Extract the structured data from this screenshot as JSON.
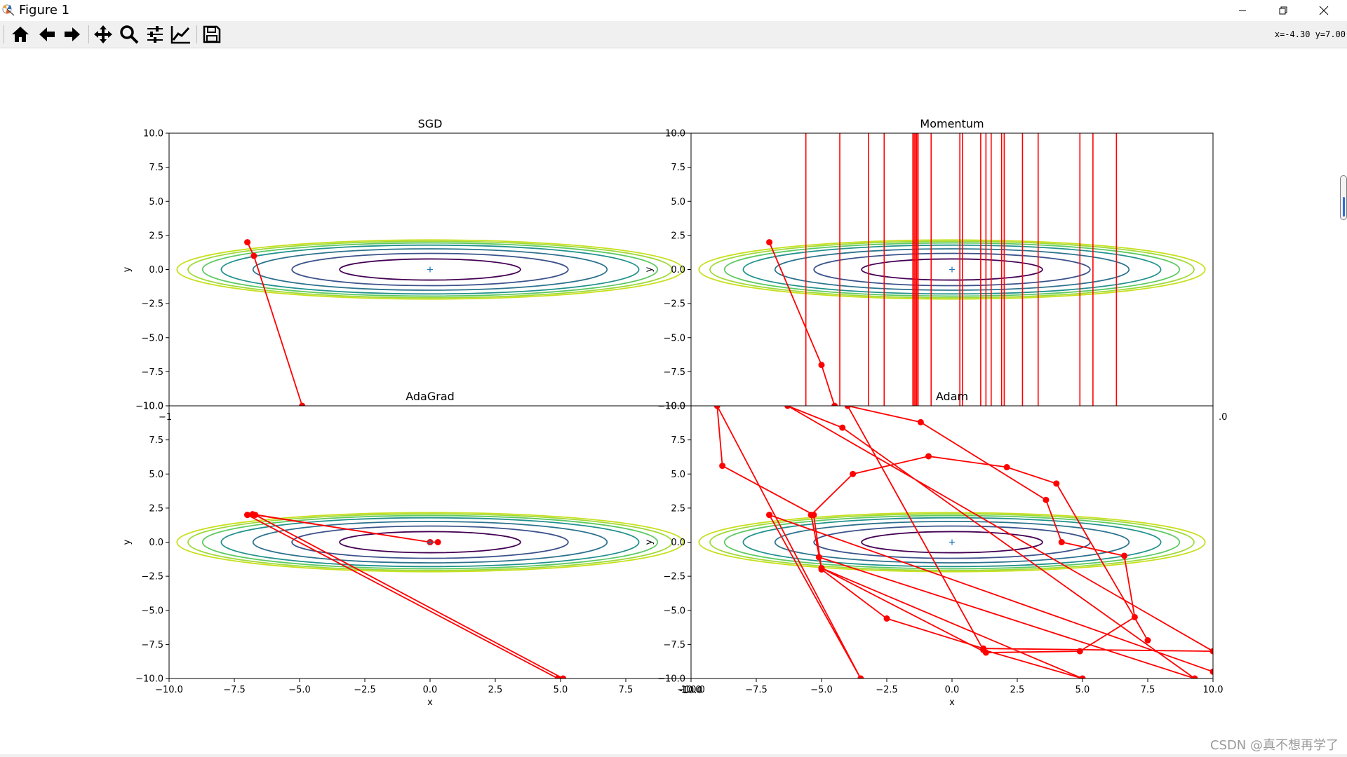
{
  "window": {
    "title": "Figure 1",
    "controls": {
      "minimize": "minimize-icon",
      "restore": "restore-icon",
      "close": "close-icon"
    }
  },
  "toolbar": {
    "buttons": [
      "home-icon",
      "back-icon",
      "forward-icon",
      "pan-icon",
      "zoom-icon",
      "subplots-icon",
      "customize-icon",
      "save-icon"
    ],
    "coords": "x=-4.30 y=7.00"
  },
  "figure": {
    "tick_labels": [
      "-10.0",
      "-7.5",
      "-5.0",
      "-2.5",
      "0.0",
      "2.5",
      "5.0",
      "7.5",
      "10.0"
    ],
    "overlap_labels": {
      "bottom_x": "-10.0",
      "left_sgd_x": "−1",
      "right_momentum_x": ".0"
    },
    "xlabel": "x",
    "ylabel": "y",
    "colors": {
      "path": "#ff0000",
      "marker": "#1f77b4",
      "axes": "#000000"
    },
    "contour_colors": [
      "#440154",
      "#3b528b",
      "#21918c",
      "#5ec962",
      "#fde725"
    ]
  },
  "chart_data": [
    {
      "type": "line",
      "title": "SGD",
      "xlabel": "",
      "ylabel": "y",
      "xlim": [
        -10,
        10
      ],
      "ylim": [
        -10,
        10
      ],
      "contour": "f(x,y) = x^2/20 + y^2",
      "minimum": [
        0,
        0
      ],
      "x": [
        -7.0,
        -6.75,
        -4.9
      ],
      "y": [
        2.0,
        1.0,
        -10.0
      ]
    },
    {
      "type": "line",
      "title": "Momentum",
      "xlabel": "",
      "ylabel": "y",
      "xlim": [
        -10,
        10
      ],
      "ylim": [
        -10,
        10
      ],
      "contour": "f(x,y) = x^2/20 + y^2",
      "minimum": [
        0,
        0
      ],
      "x": [
        -7.0,
        -5.0,
        -4.5
      ],
      "y": [
        2.0,
        -7.0,
        -10.0
      ],
      "vertical_lines_x": [
        -5.6,
        -4.3,
        -3.2,
        -2.6,
        -1.5,
        -1.45,
        -1.4,
        -1.35,
        -1.3,
        -0.8,
        0.3,
        0.4,
        1.1,
        1.3,
        1.5,
        1.9,
        2.0,
        2.7,
        3.3,
        4.9,
        5.4,
        6.3
      ]
    },
    {
      "type": "line",
      "title": "AdaGrad",
      "xlabel": "x",
      "ylabel": "y",
      "xlim": [
        -10,
        10
      ],
      "ylim": [
        -10,
        10
      ],
      "contour": "f(x,y) = x^2/20 + y^2",
      "minimum": [
        0,
        0
      ],
      "x": [
        -7.0,
        -6.8,
        0.0,
        0.3,
        0.0,
        -6.7,
        5.1,
        4.9,
        -7.0
      ],
      "y": [
        2.0,
        2.05,
        0.0,
        0.0,
        0.0,
        2.0,
        -10.0,
        -10.0,
        2.0
      ]
    },
    {
      "type": "line",
      "title": "Adam",
      "xlabel": "x",
      "ylabel": "y",
      "xlim": [
        -10,
        10
      ],
      "ylim": [
        -10,
        10
      ],
      "contour": "f(x,y) = x^2/20 + y^2",
      "minimum": [
        0,
        0
      ],
      "x": [
        -7.0,
        10.0,
        -7.0,
        -3.5,
        -9.0,
        -8.8,
        -5.3,
        -5.0,
        -2.5,
        1.2,
        10.0,
        -6.3,
        -4.2,
        9.3,
        -5.1,
        -5.0,
        1.3,
        4.9,
        7.0,
        6.6,
        4.2,
        3.6,
        -1.2,
        -4.0,
        1.2,
        5.0,
        -5.0,
        -5.4,
        -3.8,
        -0.9,
        2.1,
        4.0,
        7.5
      ],
      "y": [
        2.0,
        -9.5,
        2.0,
        -10.0,
        10.0,
        5.6,
        2.0,
        -2.0,
        -5.6,
        -7.8,
        -8.0,
        10.0,
        8.4,
        -10.0,
        -1.1,
        -1.9,
        -8.1,
        -8.0,
        -5.5,
        -1.0,
        0.0,
        3.1,
        8.8,
        10.0,
        -7.9,
        -10.0,
        -1.9,
        2.0,
        5.0,
        6.3,
        5.5,
        4.3,
        -7.2
      ]
    }
  ]
}
